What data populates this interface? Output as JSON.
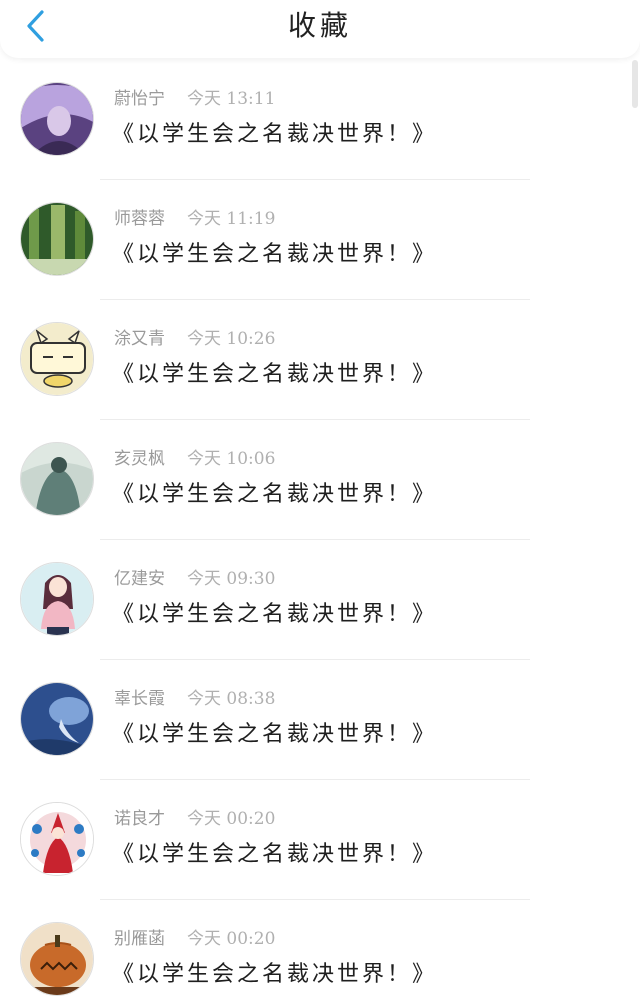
{
  "header": {
    "title": "收藏",
    "back_icon": "chevron-left-icon",
    "accent_color": "#2f9fe0"
  },
  "favorites": [
    {
      "name": "蔚怡宁",
      "time": "今天 13:11",
      "message": "《以学生会之名裁决世界！》",
      "avatar_colors": [
        "#7a5aa8",
        "#c9b6e6",
        "#3a2a55"
      ]
    },
    {
      "name": "师蓉蓉",
      "time": "今天 11:19",
      "message": "《以学生会之名裁决世界！》",
      "avatar_colors": [
        "#2f5a2a",
        "#6f9a4a",
        "#c8d8b0"
      ]
    },
    {
      "name": "涂又青",
      "time": "今天 10:26",
      "message": "《以学生会之名裁决世界！》",
      "avatar_colors": [
        "#f3eccc",
        "#f1d66a",
        "#333333"
      ]
    },
    {
      "name": "亥灵枫",
      "time": "今天 10:06",
      "message": "《以学生会之名裁决世界！》",
      "avatar_colors": [
        "#c9d6cf",
        "#5f7f78",
        "#3d5550"
      ]
    },
    {
      "name": "亿建安",
      "time": "今天 09:30",
      "message": "《以学生会之名裁决世界！》",
      "avatar_colors": [
        "#d9eef2",
        "#f2b7c4",
        "#5a2d3c"
      ]
    },
    {
      "name": "辜长霞",
      "time": "今天 08:38",
      "message": "《以学生会之名裁决世界！》",
      "avatar_colors": [
        "#2d4f8e",
        "#7fa3d8",
        "#dbe6f6"
      ]
    },
    {
      "name": "诺良才",
      "time": "今天 00:20",
      "message": "《以学生会之名裁决世界！》",
      "avatar_colors": [
        "#ffffff",
        "#c8232f",
        "#2d7bc4"
      ]
    },
    {
      "name": "别雁菡",
      "time": "今天 00:20",
      "message": "《以学生会之名裁决世界！》",
      "avatar_colors": [
        "#c86a2a",
        "#6a3a1a",
        "#f0e0c8"
      ]
    }
  ]
}
